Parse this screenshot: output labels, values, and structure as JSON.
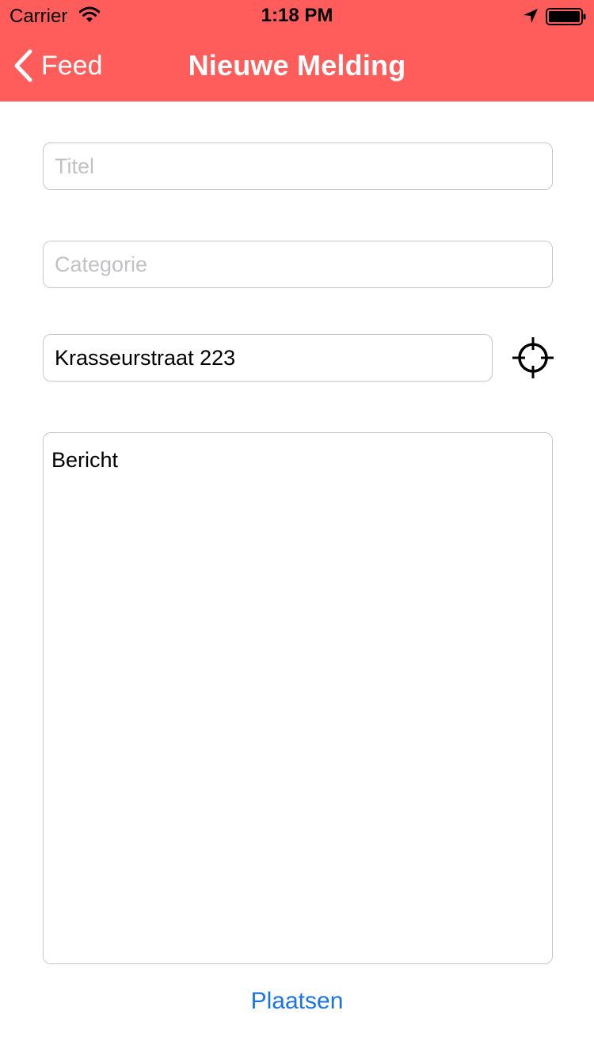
{
  "status_bar": {
    "carrier": "Carrier",
    "time": "1:18 PM"
  },
  "nav": {
    "back_label": "Feed",
    "title": "Nieuwe Melding",
    "background_color": "#FF5C5C"
  },
  "form": {
    "title_placeholder": "Titel",
    "category_placeholder": "Categorie",
    "address_value": "Krasseurstraat 223",
    "message_value": "Bericht",
    "submit_label": "Plaatsen",
    "submit_color": "#1A73E8"
  },
  "icons": {
    "wifi": "wifi-icon",
    "location": "location-arrow-icon",
    "battery": "battery-icon",
    "back": "chevron-left-icon",
    "locate": "crosshair-icon"
  }
}
